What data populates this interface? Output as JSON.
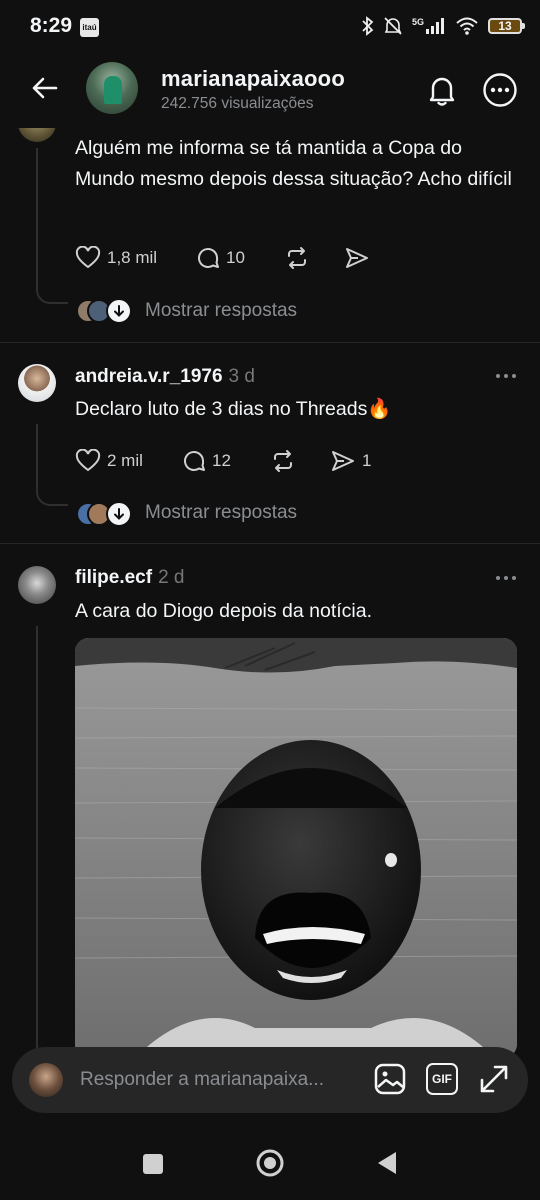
{
  "status_bar": {
    "time": "8:29",
    "carrier": "itaú",
    "network": "5G",
    "battery": "13"
  },
  "header": {
    "username": "marianapaixaooo",
    "views": "242.756 visualizações"
  },
  "posts": [
    {
      "text": "Alguém me informa se tá mantida a Copa do Mundo mesmo depois dessa situação? Acho difícil",
      "likes": "1,8 mil",
      "replies": "10",
      "show_replies": "Mostrar respostas"
    },
    {
      "username": "andreia.v.r_1976",
      "time": "3 d",
      "text": "Declaro luto de 3 dias no Threads🔥",
      "likes": "2 mil",
      "replies": "12",
      "shares": "1",
      "show_replies": "Mostrar respostas"
    },
    {
      "username": "filipe.ecf",
      "time": "2 d",
      "text": "A cara do Diogo depois da notícia."
    }
  ],
  "reply_bar": {
    "placeholder": "Responder a marianapaixa...",
    "gif_label": "GIF"
  },
  "icons": {
    "back": "arrow-left-icon",
    "bell": "bell-icon",
    "more": "more-horizontal-icon",
    "like": "heart-icon",
    "comment": "comment-icon",
    "repost": "repost-icon",
    "share": "send-icon",
    "image": "image-icon",
    "gif": "gif-icon",
    "expand": "expand-icon"
  },
  "colors": {
    "background": "#101010",
    "text": "#f3f5f7",
    "muted": "#8a8d91",
    "input_bg": "#262626"
  }
}
